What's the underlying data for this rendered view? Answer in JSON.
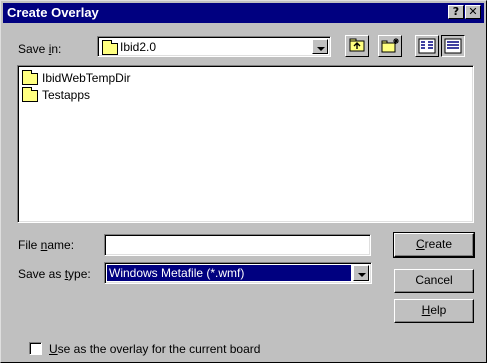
{
  "window": {
    "title": "Create Overlay",
    "help_glyph": "?",
    "close_glyph": "✕"
  },
  "save_in": {
    "label_prefix": "Save ",
    "label_accel": "i",
    "label_suffix": "n:",
    "value": "Ibid2.0"
  },
  "toolbar": {
    "icons": [
      "up-one-level-icon",
      "create-new-folder-icon",
      "list-view-icon",
      "details-view-icon"
    ]
  },
  "files": [
    {
      "name": "IbidWebTempDir",
      "icon": "folder-icon"
    },
    {
      "name": "Testapps",
      "icon": "folder-icon"
    }
  ],
  "file_name": {
    "label_prefix": "File ",
    "label_accel": "n",
    "label_suffix": "ame:",
    "value": ""
  },
  "save_as_type": {
    "label_prefix": "Save as ",
    "label_accel": "t",
    "label_suffix": "ype:",
    "value": "Windows Metafile (*.wmf)"
  },
  "buttons": {
    "create_accel": "C",
    "create_rest": "reate",
    "cancel": "Cancel",
    "help_accel": "H",
    "help_rest": "elp"
  },
  "overlay_option": {
    "label_accel": "U",
    "label_rest": "se as the overlay for the current board",
    "checked": false
  },
  "colors": {
    "titlebar": "#000080",
    "face": "#c0c0c0",
    "selection": "#000080",
    "folder": "#ffff80"
  }
}
